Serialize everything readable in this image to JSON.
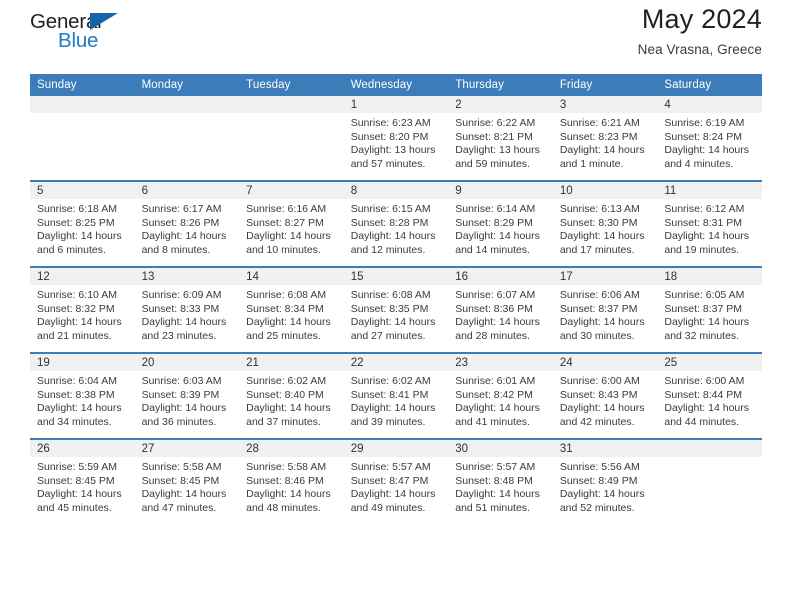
{
  "brand": {
    "name_part1": "General",
    "name_part2": "Blue"
  },
  "header": {
    "title": "May 2024",
    "subtitle": "Nea Vrasna, Greece"
  },
  "colors": {
    "header_blue": "#3b7cb9",
    "brand_blue": "#1e7bc4",
    "triangle_blue": "#1464aa",
    "daynum_band": "#f1f1f1"
  },
  "weekday_headers": [
    "Sunday",
    "Monday",
    "Tuesday",
    "Wednesday",
    "Thursday",
    "Friday",
    "Saturday"
  ],
  "weeks": [
    [
      {
        "day": "",
        "empty": true,
        "sunrise": "",
        "sunset": "",
        "daylight_line1": "",
        "daylight_line2": ""
      },
      {
        "day": "",
        "empty": true,
        "sunrise": "",
        "sunset": "",
        "daylight_line1": "",
        "daylight_line2": ""
      },
      {
        "day": "",
        "empty": true,
        "sunrise": "",
        "sunset": "",
        "daylight_line1": "",
        "daylight_line2": ""
      },
      {
        "day": "1",
        "empty": false,
        "sunrise": "Sunrise: 6:23 AM",
        "sunset": "Sunset: 8:20 PM",
        "daylight_line1": "Daylight: 13 hours",
        "daylight_line2": "and 57 minutes."
      },
      {
        "day": "2",
        "empty": false,
        "sunrise": "Sunrise: 6:22 AM",
        "sunset": "Sunset: 8:21 PM",
        "daylight_line1": "Daylight: 13 hours",
        "daylight_line2": "and 59 minutes."
      },
      {
        "day": "3",
        "empty": false,
        "sunrise": "Sunrise: 6:21 AM",
        "sunset": "Sunset: 8:23 PM",
        "daylight_line1": "Daylight: 14 hours",
        "daylight_line2": "and 1 minute."
      },
      {
        "day": "4",
        "empty": false,
        "sunrise": "Sunrise: 6:19 AM",
        "sunset": "Sunset: 8:24 PM",
        "daylight_line1": "Daylight: 14 hours",
        "daylight_line2": "and 4 minutes."
      }
    ],
    [
      {
        "day": "5",
        "empty": false,
        "sunrise": "Sunrise: 6:18 AM",
        "sunset": "Sunset: 8:25 PM",
        "daylight_line1": "Daylight: 14 hours",
        "daylight_line2": "and 6 minutes."
      },
      {
        "day": "6",
        "empty": false,
        "sunrise": "Sunrise: 6:17 AM",
        "sunset": "Sunset: 8:26 PM",
        "daylight_line1": "Daylight: 14 hours",
        "daylight_line2": "and 8 minutes."
      },
      {
        "day": "7",
        "empty": false,
        "sunrise": "Sunrise: 6:16 AM",
        "sunset": "Sunset: 8:27 PM",
        "daylight_line1": "Daylight: 14 hours",
        "daylight_line2": "and 10 minutes."
      },
      {
        "day": "8",
        "empty": false,
        "sunrise": "Sunrise: 6:15 AM",
        "sunset": "Sunset: 8:28 PM",
        "daylight_line1": "Daylight: 14 hours",
        "daylight_line2": "and 12 minutes."
      },
      {
        "day": "9",
        "empty": false,
        "sunrise": "Sunrise: 6:14 AM",
        "sunset": "Sunset: 8:29 PM",
        "daylight_line1": "Daylight: 14 hours",
        "daylight_line2": "and 14 minutes."
      },
      {
        "day": "10",
        "empty": false,
        "sunrise": "Sunrise: 6:13 AM",
        "sunset": "Sunset: 8:30 PM",
        "daylight_line1": "Daylight: 14 hours",
        "daylight_line2": "and 17 minutes."
      },
      {
        "day": "11",
        "empty": false,
        "sunrise": "Sunrise: 6:12 AM",
        "sunset": "Sunset: 8:31 PM",
        "daylight_line1": "Daylight: 14 hours",
        "daylight_line2": "and 19 minutes."
      }
    ],
    [
      {
        "day": "12",
        "empty": false,
        "sunrise": "Sunrise: 6:10 AM",
        "sunset": "Sunset: 8:32 PM",
        "daylight_line1": "Daylight: 14 hours",
        "daylight_line2": "and 21 minutes."
      },
      {
        "day": "13",
        "empty": false,
        "sunrise": "Sunrise: 6:09 AM",
        "sunset": "Sunset: 8:33 PM",
        "daylight_line1": "Daylight: 14 hours",
        "daylight_line2": "and 23 minutes."
      },
      {
        "day": "14",
        "empty": false,
        "sunrise": "Sunrise: 6:08 AM",
        "sunset": "Sunset: 8:34 PM",
        "daylight_line1": "Daylight: 14 hours",
        "daylight_line2": "and 25 minutes."
      },
      {
        "day": "15",
        "empty": false,
        "sunrise": "Sunrise: 6:08 AM",
        "sunset": "Sunset: 8:35 PM",
        "daylight_line1": "Daylight: 14 hours",
        "daylight_line2": "and 27 minutes."
      },
      {
        "day": "16",
        "empty": false,
        "sunrise": "Sunrise: 6:07 AM",
        "sunset": "Sunset: 8:36 PM",
        "daylight_line1": "Daylight: 14 hours",
        "daylight_line2": "and 28 minutes."
      },
      {
        "day": "17",
        "empty": false,
        "sunrise": "Sunrise: 6:06 AM",
        "sunset": "Sunset: 8:37 PM",
        "daylight_line1": "Daylight: 14 hours",
        "daylight_line2": "and 30 minutes."
      },
      {
        "day": "18",
        "empty": false,
        "sunrise": "Sunrise: 6:05 AM",
        "sunset": "Sunset: 8:37 PM",
        "daylight_line1": "Daylight: 14 hours",
        "daylight_line2": "and 32 minutes."
      }
    ],
    [
      {
        "day": "19",
        "empty": false,
        "sunrise": "Sunrise: 6:04 AM",
        "sunset": "Sunset: 8:38 PM",
        "daylight_line1": "Daylight: 14 hours",
        "daylight_line2": "and 34 minutes."
      },
      {
        "day": "20",
        "empty": false,
        "sunrise": "Sunrise: 6:03 AM",
        "sunset": "Sunset: 8:39 PM",
        "daylight_line1": "Daylight: 14 hours",
        "daylight_line2": "and 36 minutes."
      },
      {
        "day": "21",
        "empty": false,
        "sunrise": "Sunrise: 6:02 AM",
        "sunset": "Sunset: 8:40 PM",
        "daylight_line1": "Daylight: 14 hours",
        "daylight_line2": "and 37 minutes."
      },
      {
        "day": "22",
        "empty": false,
        "sunrise": "Sunrise: 6:02 AM",
        "sunset": "Sunset: 8:41 PM",
        "daylight_line1": "Daylight: 14 hours",
        "daylight_line2": "and 39 minutes."
      },
      {
        "day": "23",
        "empty": false,
        "sunrise": "Sunrise: 6:01 AM",
        "sunset": "Sunset: 8:42 PM",
        "daylight_line1": "Daylight: 14 hours",
        "daylight_line2": "and 41 minutes."
      },
      {
        "day": "24",
        "empty": false,
        "sunrise": "Sunrise: 6:00 AM",
        "sunset": "Sunset: 8:43 PM",
        "daylight_line1": "Daylight: 14 hours",
        "daylight_line2": "and 42 minutes."
      },
      {
        "day": "25",
        "empty": false,
        "sunrise": "Sunrise: 6:00 AM",
        "sunset": "Sunset: 8:44 PM",
        "daylight_line1": "Daylight: 14 hours",
        "daylight_line2": "and 44 minutes."
      }
    ],
    [
      {
        "day": "26",
        "empty": false,
        "sunrise": "Sunrise: 5:59 AM",
        "sunset": "Sunset: 8:45 PM",
        "daylight_line1": "Daylight: 14 hours",
        "daylight_line2": "and 45 minutes."
      },
      {
        "day": "27",
        "empty": false,
        "sunrise": "Sunrise: 5:58 AM",
        "sunset": "Sunset: 8:45 PM",
        "daylight_line1": "Daylight: 14 hours",
        "daylight_line2": "and 47 minutes."
      },
      {
        "day": "28",
        "empty": false,
        "sunrise": "Sunrise: 5:58 AM",
        "sunset": "Sunset: 8:46 PM",
        "daylight_line1": "Daylight: 14 hours",
        "daylight_line2": "and 48 minutes."
      },
      {
        "day": "29",
        "empty": false,
        "sunrise": "Sunrise: 5:57 AM",
        "sunset": "Sunset: 8:47 PM",
        "daylight_line1": "Daylight: 14 hours",
        "daylight_line2": "and 49 minutes."
      },
      {
        "day": "30",
        "empty": false,
        "sunrise": "Sunrise: 5:57 AM",
        "sunset": "Sunset: 8:48 PM",
        "daylight_line1": "Daylight: 14 hours",
        "daylight_line2": "and 51 minutes."
      },
      {
        "day": "31",
        "empty": false,
        "sunrise": "Sunrise: 5:56 AM",
        "sunset": "Sunset: 8:49 PM",
        "daylight_line1": "Daylight: 14 hours",
        "daylight_line2": "and 52 minutes."
      },
      {
        "day": "",
        "empty": true,
        "sunrise": "",
        "sunset": "",
        "daylight_line1": "",
        "daylight_line2": ""
      }
    ]
  ]
}
